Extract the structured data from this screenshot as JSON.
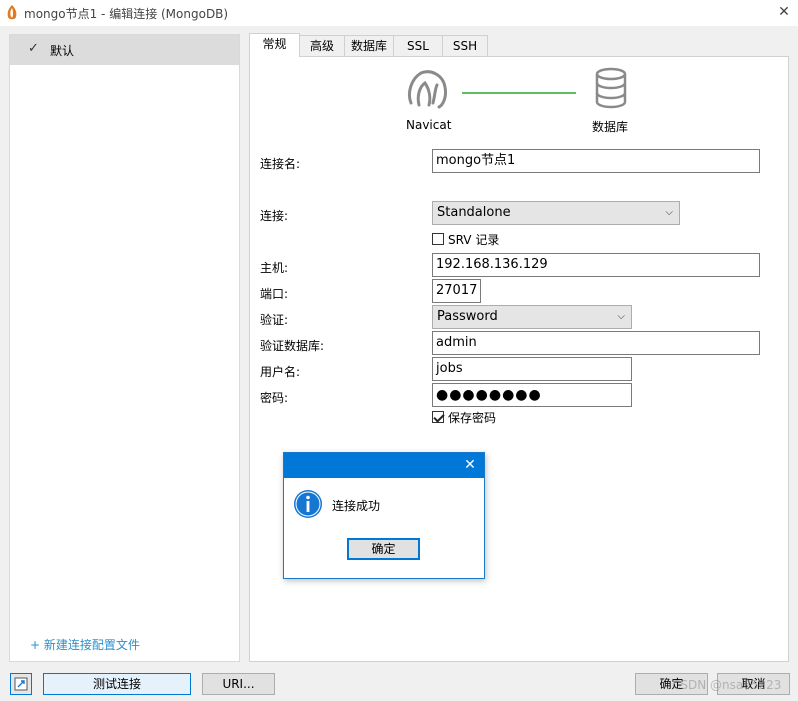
{
  "window": {
    "title": "mongo节点1 - 编辑连接 (MongoDB)",
    "close_glyph": "✕"
  },
  "sidebar": {
    "profile_check_glyph": "✓",
    "profile_label": "默认",
    "new_profile_label": "+ 新建连接配置文件"
  },
  "tabs": [
    {
      "label": "常规",
      "active": true
    },
    {
      "label": "高级"
    },
    {
      "label": "数据库"
    },
    {
      "label": "SSL"
    },
    {
      "label": "SSH"
    }
  ],
  "header": {
    "left_label": "Navicat",
    "right_label": "数据库",
    "line_color": "#5cbf61"
  },
  "form": {
    "name_label": "连接名:",
    "name_value": "mongo节点1",
    "connection_label": "连接:",
    "connection_value": "Standalone",
    "srv_label": "SRV 记录",
    "srv_checked": false,
    "host_label": "主机:",
    "host_value": "192.168.136.129",
    "port_label": "端口:",
    "port_value": "27017",
    "auth_label": "验证:",
    "auth_value": "Password",
    "authdb_label": "验证数据库:",
    "authdb_value": "admin",
    "user_label": "用户名:",
    "user_value": "jobs",
    "password_label": "密码:",
    "password_value": "●●●●●●●●",
    "save_password_label": "保存密码",
    "save_password_checked": true
  },
  "dialog": {
    "message": "连接成功",
    "ok_label": "确定",
    "close_glyph": "✕",
    "accent": "#0078d7"
  },
  "footer": {
    "test_label": "测试连接",
    "uri_label": "URI...",
    "ok_label": "确定",
    "cancel_label": "取消",
    "watermark": "CSDN @nsa65223"
  }
}
